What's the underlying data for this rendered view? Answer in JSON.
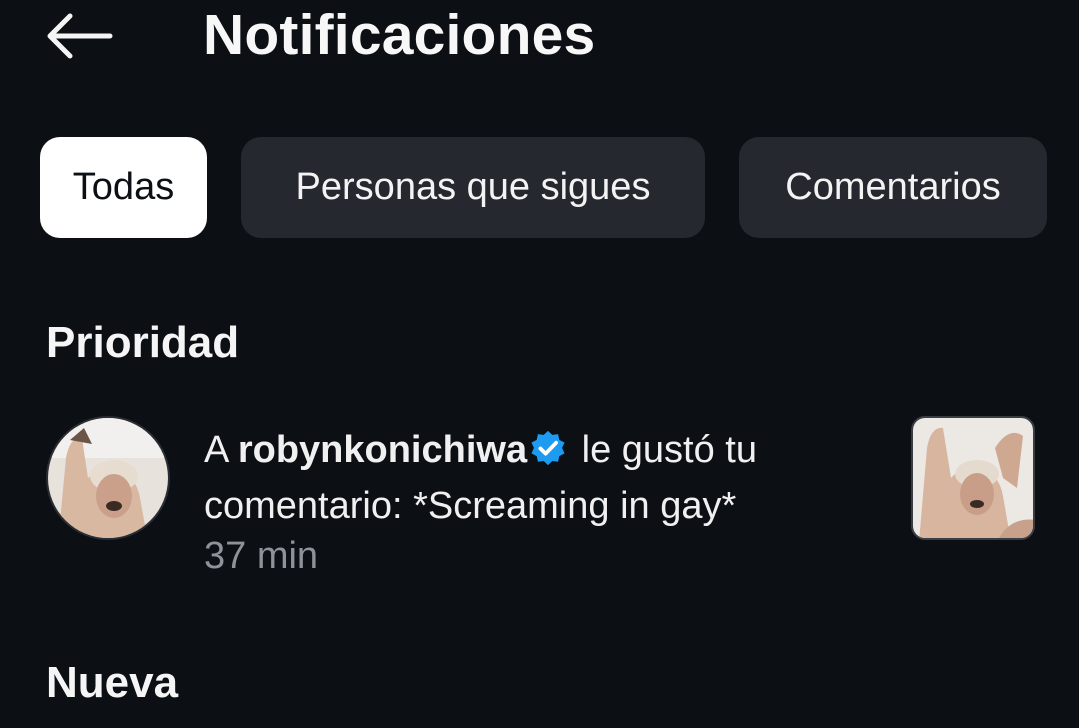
{
  "header": {
    "title": "Notificaciones",
    "back_icon": "arrow-left-icon"
  },
  "tabs": [
    {
      "label": "Todas",
      "active": true
    },
    {
      "label": "Personas que sigues",
      "active": false
    },
    {
      "label": "Comentarios",
      "active": false
    }
  ],
  "sections": {
    "priority_title": "Prioridad",
    "new_title": "Nueva"
  },
  "notification": {
    "prefix": "A ",
    "username": "robynkonichiwa",
    "verified_icon": "verified-badge-icon",
    "action_line1": " le gustó tu",
    "action_line2": "comentario: *Screaming in gay*",
    "time": "37 min"
  },
  "colors": {
    "background": "#0c0f14",
    "tab_inactive": "#25282e",
    "tab_active": "#ffffff",
    "verified": "#1d9bf0",
    "muted_text": "#8e939b"
  }
}
